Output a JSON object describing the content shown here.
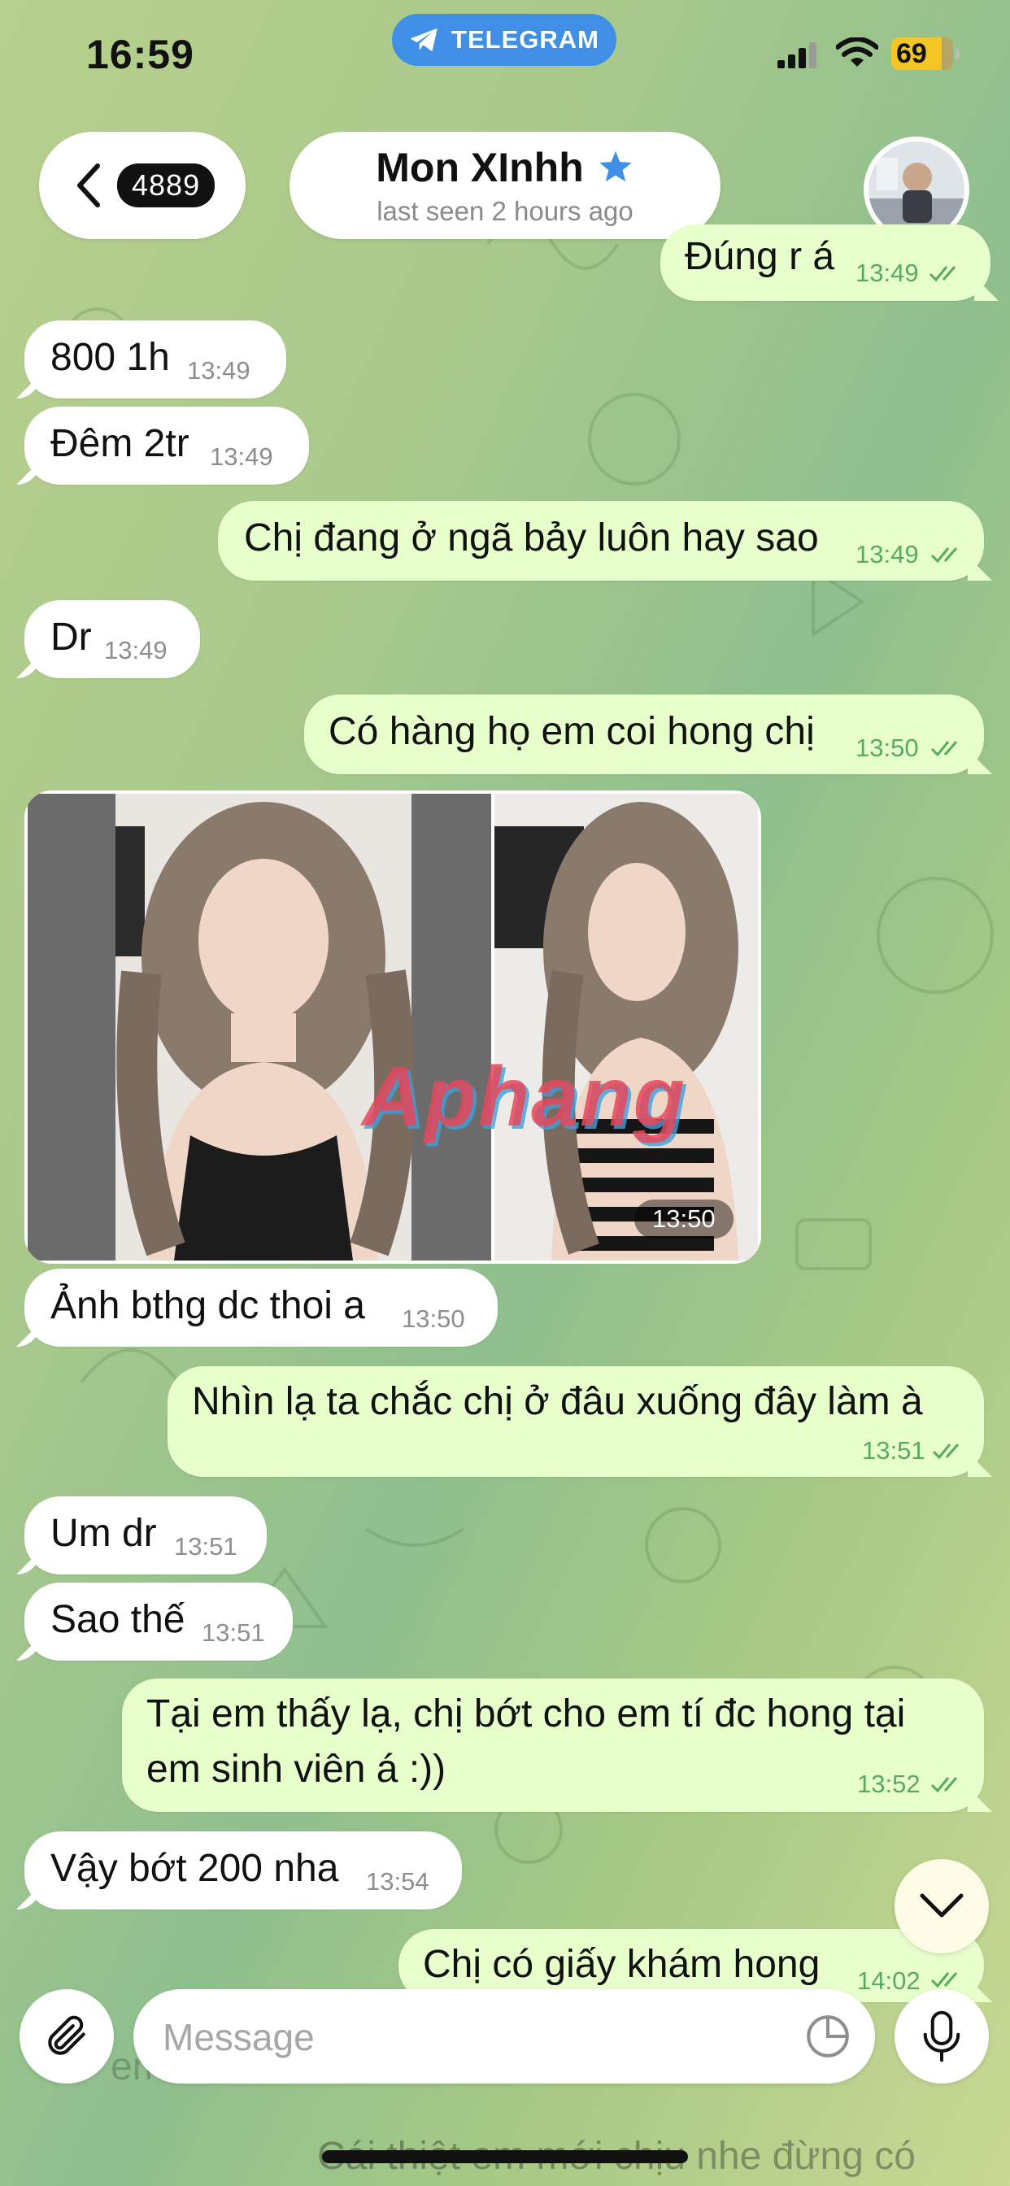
{
  "status_bar": {
    "time": "16:59",
    "pill_label": "TELEGRAM",
    "battery": "69"
  },
  "header": {
    "back_count": "4889",
    "name": "Mon XInhh",
    "subtitle": "last seen 2 hours ago"
  },
  "messages": [
    {
      "dir": "out",
      "text": "Đúng r á",
      "time": "13:49",
      "read": true
    },
    {
      "dir": "in",
      "text": "800 1h",
      "time": "13:49"
    },
    {
      "dir": "in",
      "text": "Đêm 2tr",
      "time": "13:49"
    },
    {
      "dir": "out",
      "text": "Chị đang ở ngã bảy luôn hay sao",
      "time": "13:49",
      "read": true
    },
    {
      "dir": "in",
      "text": "Dr",
      "time": "13:49"
    },
    {
      "dir": "out",
      "text": "Có hàng họ em coi hong chị",
      "time": "13:50",
      "read": true
    },
    {
      "dir": "in",
      "type": "photos",
      "time": "13:50",
      "watermark": "Aphang"
    },
    {
      "dir": "in",
      "text": "Ảnh bthg dc thoi a",
      "time": "13:50"
    },
    {
      "dir": "out",
      "text": "Nhìn lạ ta chắc chị ở đâu xuống đây làm à",
      "time": "13:51",
      "read": true
    },
    {
      "dir": "in",
      "text": "Um dr",
      "time": "13:51"
    },
    {
      "dir": "in",
      "text": "Sao thế",
      "time": "13:51"
    },
    {
      "dir": "out",
      "text": "Tại em thấy lạ, chị bớt cho em tí đc hong tại",
      "text2": "em sinh viên á :))",
      "time": "13:52",
      "read": true
    },
    {
      "dir": "in",
      "text": "Vậy bớt 200 nha",
      "time": "13:54"
    },
    {
      "dir": "out",
      "text": "Chị có giấy khám hong",
      "time": "14:02",
      "read": true
    }
  ],
  "ghost_texts": {
    "behind_input": "em",
    "bottom": "Cái thiệt em mới chịu nhe đừng có"
  },
  "composer": {
    "placeholder": "Message"
  },
  "colors": {
    "incoming": "#ffffff",
    "outgoing": "#e6ffcb",
    "accent": "#3f8fe6",
    "read_ticks": "#5aaa5e"
  },
  "icons": {
    "telegram": "telegram-plane-icon",
    "signal": "signal-bars-icon",
    "wifi": "wifi-icon",
    "back": "chevron-left-icon",
    "star": "premium-star-icon",
    "attach": "paperclip-icon",
    "sticker": "sticker-icon",
    "mic": "microphone-icon",
    "scroll": "chevron-down-icon"
  }
}
